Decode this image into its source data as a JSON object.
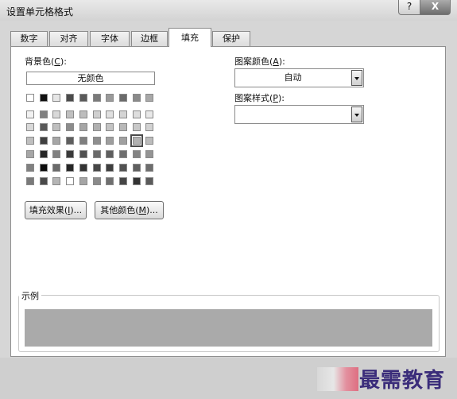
{
  "window": {
    "title": "设置单元格格式",
    "help_label": "?",
    "close_label": "X"
  },
  "tabs": [
    {
      "label": "数字",
      "active": false
    },
    {
      "label": "对齐",
      "active": false
    },
    {
      "label": "字体",
      "active": false
    },
    {
      "label": "边框",
      "active": false
    },
    {
      "label": "填充",
      "active": true
    },
    {
      "label": "保护",
      "active": false
    }
  ],
  "background_color": {
    "label_prefix": "背景色(",
    "hotkey": "C",
    "label_suffix": "):",
    "no_color_label": "无颜色",
    "palette": {
      "theme_row": [
        "#ffffff",
        "#111111",
        "#e6e6e6",
        "#4b4b4b",
        "#5a5a5a",
        "#7a7a7a",
        "#9a9a9a",
        "#6a6a6a",
        "#8a8a8a",
        "#a8a8a8"
      ],
      "shade_rows": [
        [
          "#f2f2f2",
          "#808080",
          "#d9d9d9",
          "#c0c0c0",
          "#bdbdbd",
          "#cfcfcf",
          "#e0e0e0",
          "#d4d4d4",
          "#dedede",
          "#e8e8e8"
        ],
        [
          "#d9d9d9",
          "#595959",
          "#bfbfbf",
          "#8c8c8c",
          "#a6a6a6",
          "#b0b0b0",
          "#c4c4c4",
          "#b8b8b8",
          "#c8c8c8",
          "#d2d2d2"
        ],
        [
          "#bfbfbf",
          "#404040",
          "#a6a6a6",
          "#5e5e5e",
          "#7f7f7f",
          "#8e8e8e",
          "#9e9e9e",
          "#a0a0a0",
          "#b2b2b2",
          "#bcbcbc"
        ],
        [
          "#a6a6a6",
          "#262626",
          "#808080",
          "#3a3a3a",
          "#505050",
          "#6a6a6a",
          "#5e5e5e",
          "#6e6e6e",
          "#838383",
          "#949494"
        ],
        [
          "#808080",
          "#0d0d0d",
          "#6a6a6a",
          "#262626",
          "#333333",
          "#474747",
          "#3e3e3e",
          "#525252",
          "#5f5f5f",
          "#6d6d6d"
        ]
      ],
      "standard_row": [
        "#7a7a7a",
        "#4a4a4a",
        "#b5b5b5",
        "#ffffff",
        "#a5a5a5",
        "#8a8a8a",
        "#6f6f6f",
        "#454545",
        "#333333",
        "#5a5a5a"
      ]
    }
  },
  "buttons": {
    "fill_effects": {
      "prefix": "填充效果(",
      "hotkey": "I",
      "suffix": ")..."
    },
    "more_colors": {
      "prefix": "其他颜色(",
      "hotkey": "M",
      "suffix": ")..."
    }
  },
  "pattern_color": {
    "label_prefix": "图案颜色(",
    "hotkey": "A",
    "label_suffix": "):",
    "value": "自动"
  },
  "pattern_style": {
    "label_prefix": "图案样式(",
    "hotkey": "P",
    "label_suffix": "):",
    "value": ""
  },
  "sample": {
    "label": "示例",
    "fill_color": "#aaaaaa"
  },
  "watermark": {
    "text": "最需教育"
  }
}
